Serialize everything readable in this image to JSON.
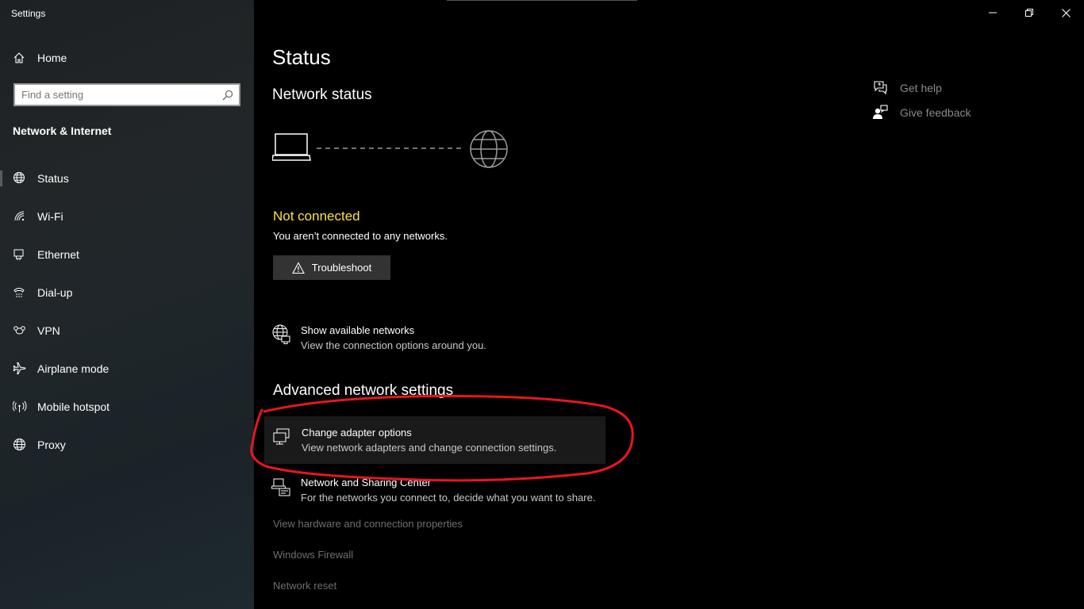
{
  "window": {
    "title": "Settings",
    "controls": {
      "minimize": "minimize-icon",
      "restore": "restore-icon",
      "close": "close-icon"
    }
  },
  "sidebar": {
    "home_label": "Home",
    "search_placeholder": "Find a setting",
    "section_title": "Network & Internet",
    "items": [
      {
        "label": "Status",
        "icon": "globe-network-icon",
        "active": true
      },
      {
        "label": "Wi-Fi",
        "icon": "wifi-icon"
      },
      {
        "label": "Ethernet",
        "icon": "ethernet-icon"
      },
      {
        "label": "Dial-up",
        "icon": "dialup-icon"
      },
      {
        "label": "VPN",
        "icon": "vpn-icon"
      },
      {
        "label": "Airplane mode",
        "icon": "airplane-icon"
      },
      {
        "label": "Mobile hotspot",
        "icon": "hotspot-icon"
      },
      {
        "label": "Proxy",
        "icon": "globe-icon"
      }
    ]
  },
  "main": {
    "title": "Status",
    "network_status_heading": "Network status",
    "status_label": "Not connected",
    "status_description": "You aren’t connected to any networks.",
    "troubleshoot_label": "Troubleshoot",
    "show_networks": {
      "title": "Show available networks",
      "description": "View the connection options around you."
    },
    "advanced_heading": "Advanced network settings",
    "change_adapter": {
      "title": "Change adapter options",
      "description": "View network adapters and change connection settings."
    },
    "sharing_center": {
      "title": "Network and Sharing Center",
      "description": "For the networks you connect to, decide what you want to share."
    },
    "links": [
      "View hardware and connection properties",
      "Windows Firewall",
      "Network reset"
    ]
  },
  "help": {
    "get_help": "Get help",
    "give_feedback": "Give feedback"
  },
  "colors": {
    "status_warning": "#ffe23a",
    "annotation_circle": "#e8161c"
  }
}
